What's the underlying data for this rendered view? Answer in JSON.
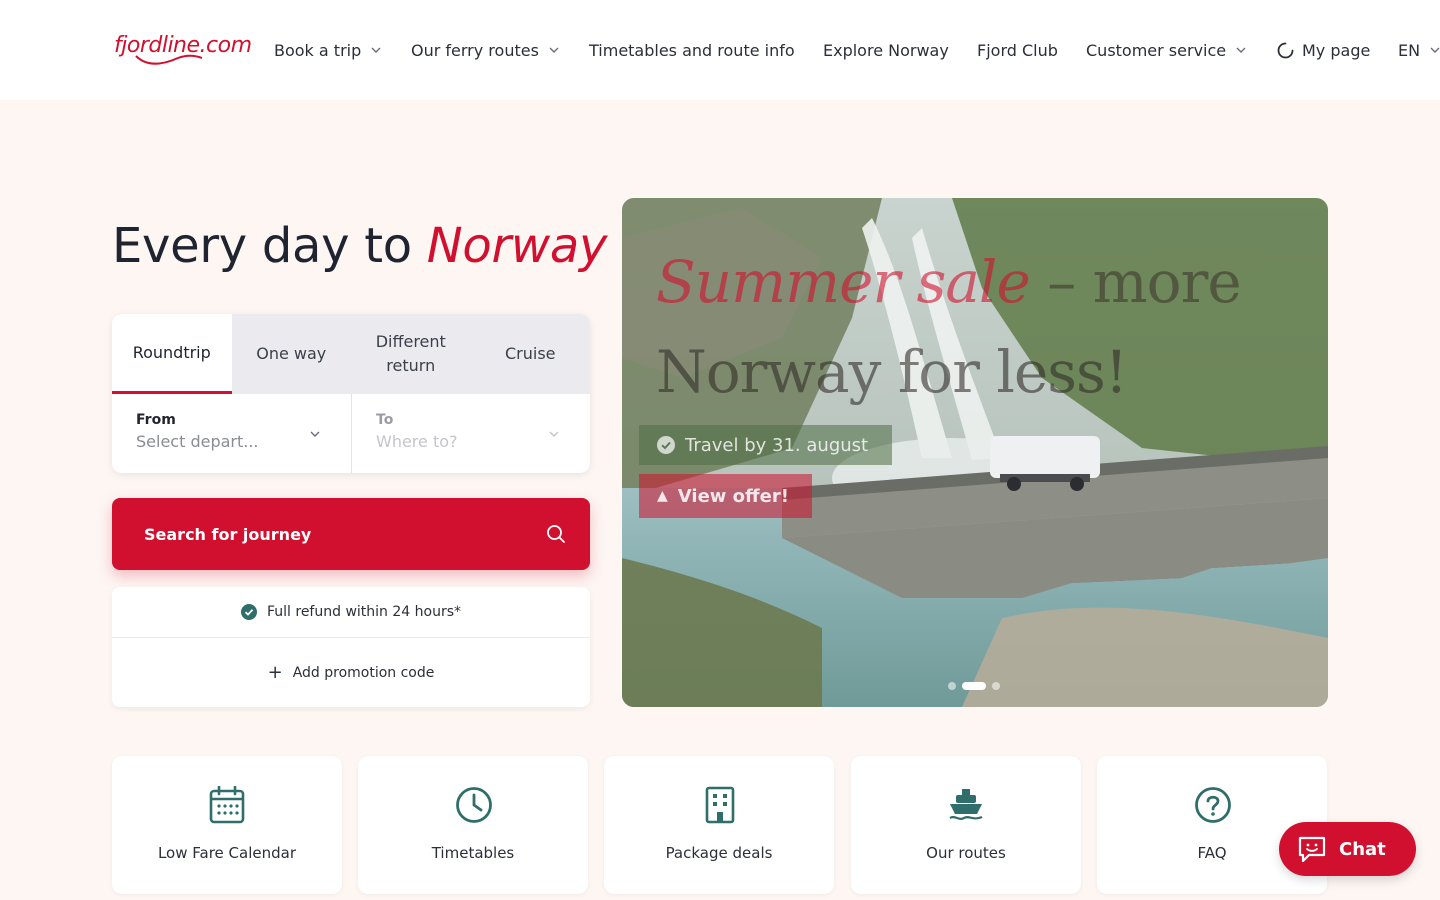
{
  "brand": {
    "logo_text": "fjordline.com",
    "accent_color": "#d0102e",
    "teal_color": "#2f6e6a"
  },
  "nav": {
    "items": [
      {
        "label": "Book a trip",
        "dropdown": true
      },
      {
        "label": "Our ferry routes",
        "dropdown": true
      },
      {
        "label": "Timetables and route info",
        "dropdown": false
      },
      {
        "label": "Explore Norway",
        "dropdown": false
      },
      {
        "label": "Fjord Club",
        "dropdown": false
      },
      {
        "label": "Customer service",
        "dropdown": true
      }
    ],
    "my_page": "My page",
    "language": "EN"
  },
  "hero": {
    "title_prefix": "Every day to ",
    "title_highlight": "Norway"
  },
  "booking": {
    "tabs": [
      "Roundtrip",
      "One way",
      "Different return",
      "Cruise"
    ],
    "active_tab": "Roundtrip",
    "from": {
      "label": "From",
      "placeholder": "Select depart..."
    },
    "to": {
      "label": "To",
      "placeholder": "Where to?"
    },
    "search_label": "Search for journey",
    "refund_text": "Full refund within 24 hours*",
    "promo_text": "Add promotion code"
  },
  "promo_banner": {
    "title_highlight": "Summer sale",
    "title_rest": " – more",
    "title_line2": "Norway for less!",
    "badge": "Travel by 31. august",
    "cta": "View offer!",
    "slides_total": 3,
    "active_slide": 2
  },
  "quick_links": [
    {
      "label": "Low Fare Calendar",
      "icon": "calendar-icon"
    },
    {
      "label": "Timetables",
      "icon": "clock-icon"
    },
    {
      "label": "Package deals",
      "icon": "building-icon"
    },
    {
      "label": "Our routes",
      "icon": "ship-icon"
    },
    {
      "label": "FAQ",
      "icon": "question-icon"
    }
  ],
  "chat": {
    "label": "Chat"
  }
}
